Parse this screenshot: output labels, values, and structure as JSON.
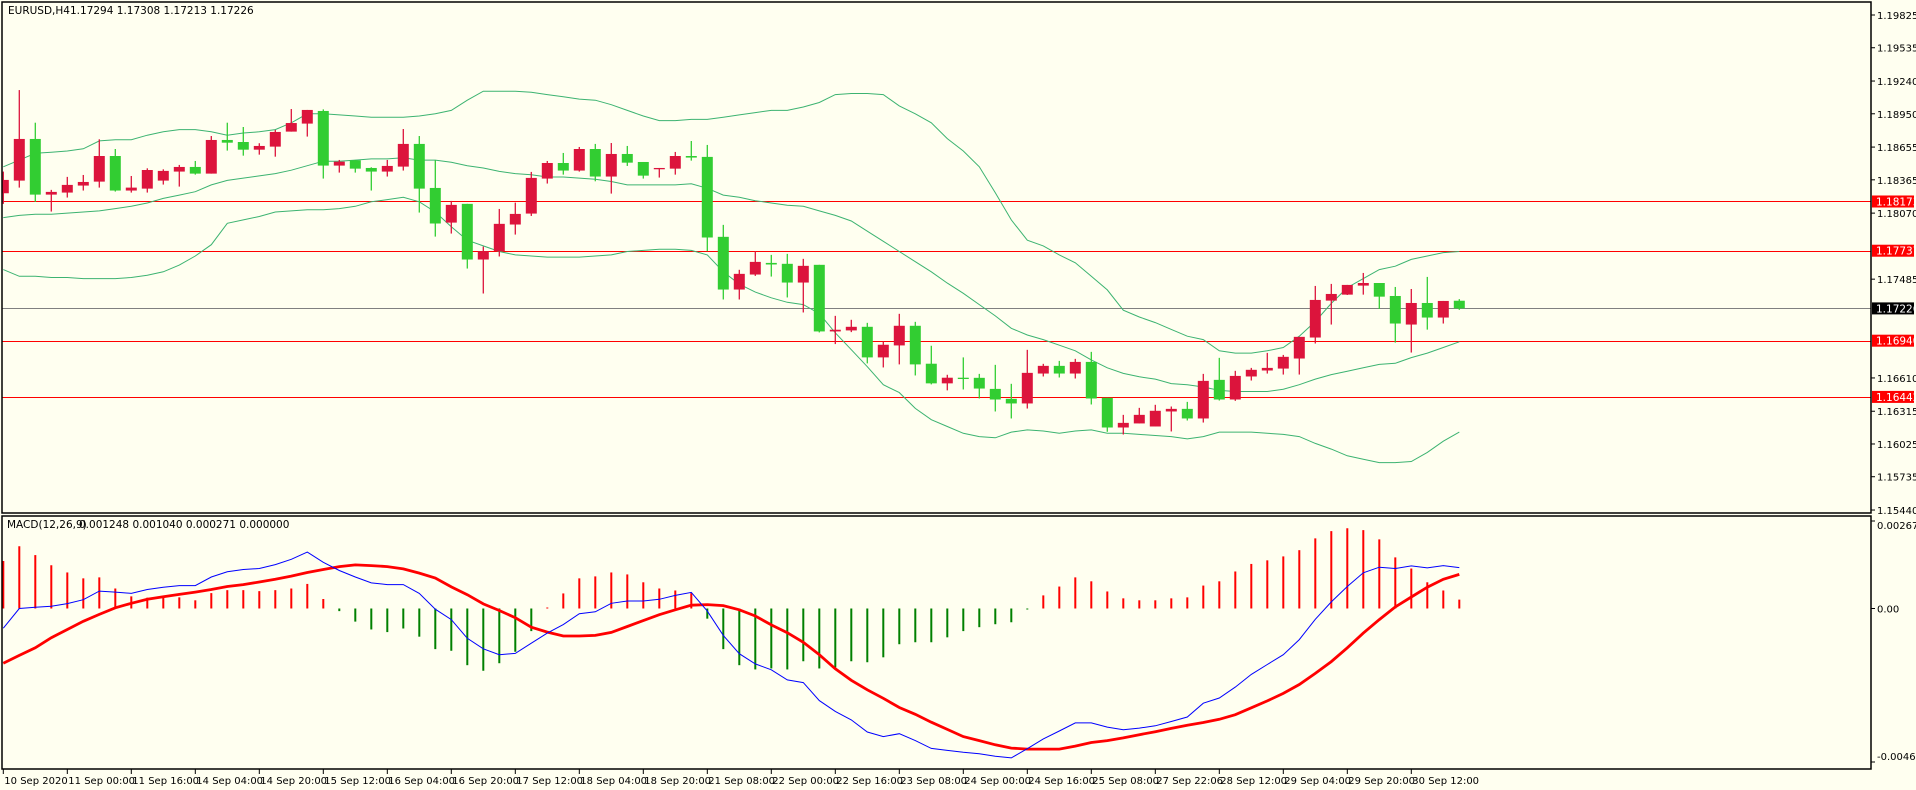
{
  "header": {
    "symbol": "EURUSD,H4",
    "ohlc": "1.17294 1.17308 1.17213 1.17226"
  },
  "macd_legend": {
    "label": "MACD(12,26,9)",
    "values": "0.001248 0.001040 0.000271 0.000000"
  },
  "colors": {
    "background": "#fffff0",
    "bull": "#dc143c",
    "bear": "#32cd32",
    "bands": "#3cb371",
    "level": "#ff0000",
    "bid": "#808080",
    "macd": "#0000ff",
    "signal": "#ff0000",
    "hist_pos": "#ff0000",
    "hist_neg": "#008000"
  },
  "price_axis": {
    "ticks": [
      "1.19825",
      "1.19535",
      "1.19240",
      "1.18950",
      "1.18655",
      "1.18365",
      "1.18070",
      "1.17485",
      "1.16610",
      "1.16315",
      "1.16025",
      "1.15735",
      "1.15440"
    ]
  },
  "levels": [
    {
      "price": "1.18173",
      "kind": "level"
    },
    {
      "price": "1.17737",
      "kind": "level"
    },
    {
      "price": "1.16940",
      "kind": "level"
    },
    {
      "price": "1.16442",
      "kind": "level"
    },
    {
      "price": "1.17226",
      "kind": "bid"
    }
  ],
  "macd_axis": {
    "ticks": [
      "0.00267",
      "0.00",
      "-0.004685"
    ]
  },
  "time_axis": {
    "labels": [
      "10 Sep 2020",
      "11 Sep 00:00",
      "11 Sep 16:00",
      "14 Sep 04:00",
      "14 Sep 20:00",
      "15 Sep 12:00",
      "16 Sep 04:00",
      "16 Sep 20:00",
      "17 Sep 12:00",
      "18 Sep 04:00",
      "18 Sep 20:00",
      "21 Sep 08:00",
      "22 Sep 00:00",
      "22 Sep 16:00",
      "23 Sep 08:00",
      "24 Sep 00:00",
      "24 Sep 16:00",
      "25 Sep 08:00",
      "27 Sep 22:06",
      "28 Sep 12:00",
      "29 Sep 04:00",
      "29 Sep 20:00",
      "30 Sep 12:00"
    ],
    "every_n_bars": 4
  },
  "chart_data": {
    "type": "candlestick",
    "title": "EURUSD,H4",
    "ylim": [
      1.154,
      1.1995
    ],
    "ohlc": [
      [
        1.18246,
        1.18438,
        1.18152,
        1.18364
      ],
      [
        1.18358,
        1.1916,
        1.18296,
        1.18727
      ],
      [
        1.18727,
        1.18871,
        1.18169,
        1.18234
      ],
      [
        1.18234,
        1.18276,
        1.18084,
        1.18258
      ],
      [
        1.18252,
        1.18391,
        1.18208,
        1.1832
      ],
      [
        1.18314,
        1.18408,
        1.1827,
        1.18346
      ],
      [
        1.18349,
        1.18724,
        1.18296,
        1.18576
      ],
      [
        1.18576,
        1.18638,
        1.18261,
        1.1827
      ],
      [
        1.1827,
        1.18399,
        1.18252,
        1.18296
      ],
      [
        1.18287,
        1.18467,
        1.18252,
        1.18452
      ],
      [
        1.18358,
        1.18458,
        1.18323,
        1.18444
      ],
      [
        1.18438,
        1.18497,
        1.18305,
        1.18479
      ],
      [
        1.18479,
        1.18532,
        1.18411,
        1.1842
      ],
      [
        1.1842,
        1.18753,
        1.1842,
        1.18718
      ],
      [
        1.18718,
        1.18871,
        1.18624,
        1.18694
      ],
      [
        1.187,
        1.18833,
        1.18579,
        1.18632
      ],
      [
        1.18632,
        1.18689,
        1.18588,
        1.18665
      ],
      [
        1.18659,
        1.18807,
        1.1857,
        1.18789
      ],
      [
        1.18792,
        1.18992,
        1.18792,
        1.18868
      ],
      [
        1.18863,
        1.18984,
        1.18748,
        1.18984
      ],
      [
        1.18975,
        1.18989,
        1.18376,
        1.18491
      ],
      [
        1.18491,
        1.18541,
        1.18429,
        1.18526
      ],
      [
        1.18538,
        1.18541,
        1.18429,
        1.18464
      ],
      [
        1.1847,
        1.18476,
        1.1827,
        1.18438
      ],
      [
        1.18438,
        1.18541,
        1.18394,
        1.18488
      ],
      [
        1.18482,
        1.18815,
        1.18447,
        1.18683
      ],
      [
        1.18683,
        1.18753,
        1.18075,
        1.18287
      ],
      [
        1.18293,
        1.18538,
        1.17862,
        1.17978
      ],
      [
        1.17986,
        1.18178,
        1.17889,
        1.18143
      ],
      [
        1.18152,
        1.18152,
        1.17579,
        1.17659
      ],
      [
        1.17659,
        1.17774,
        1.17358,
        1.17733
      ],
      [
        1.17733,
        1.18107,
        1.17686,
        1.17975
      ],
      [
        1.17969,
        1.18163,
        1.1788,
        1.18063
      ],
      [
        1.18066,
        1.18435,
        1.18045,
        1.18382
      ],
      [
        1.18376,
        1.18532,
        1.18332,
        1.18514
      ],
      [
        1.18514,
        1.18603,
        1.18411,
        1.18447
      ],
      [
        1.18447,
        1.18656,
        1.18438,
        1.18638
      ],
      [
        1.18638,
        1.18683,
        1.18352,
        1.18394
      ],
      [
        1.18394,
        1.18691,
        1.18243,
        1.18594
      ],
      [
        1.18594,
        1.18665,
        1.18488,
        1.18517
      ],
      [
        1.18523,
        1.18523,
        1.18376,
        1.18402
      ],
      [
        1.18464,
        1.1847,
        1.18385,
        1.1847
      ],
      [
        1.18464,
        1.18612,
        1.18411,
        1.18576
      ],
      [
        1.18576,
        1.18709,
        1.18535,
        1.18562
      ],
      [
        1.18568,
        1.18674,
        1.17733,
        1.17854
      ],
      [
        1.1786,
        1.17966,
        1.17305,
        1.17393
      ],
      [
        1.17393,
        1.17568,
        1.17305,
        1.17532
      ],
      [
        1.17526,
        1.17733,
        1.17514,
        1.17638
      ],
      [
        1.17629,
        1.177,
        1.17508,
        1.17615
      ],
      [
        1.17621,
        1.17709,
        1.17323,
        1.17455
      ],
      [
        1.17455,
        1.17665,
        1.1719,
        1.17603
      ],
      [
        1.17612,
        1.17612,
        1.17013,
        1.17022
      ],
      [
        1.17022,
        1.1716,
        1.1691,
        1.17037
      ],
      [
        1.17031,
        1.17125,
        1.17016,
        1.17063
      ],
      [
        1.17063,
        1.17098,
        1.16739,
        1.16792
      ],
      [
        1.16792,
        1.16933,
        1.16703,
        1.16904
      ],
      [
        1.16898,
        1.17178,
        1.1673,
        1.17072
      ],
      [
        1.17072,
        1.17107,
        1.16632,
        1.1673
      ],
      [
        1.16736,
        1.16895,
        1.16553,
        1.16562
      ],
      [
        1.16562,
        1.16638,
        1.165,
        1.16612
      ],
      [
        1.16612,
        1.16792,
        1.16508,
        1.16606
      ],
      [
        1.16611,
        1.16646,
        1.16428,
        1.16516
      ],
      [
        1.16513,
        1.16726,
        1.16313,
        1.16419
      ],
      [
        1.16425,
        1.16558,
        1.16251,
        1.16384
      ],
      [
        1.16384,
        1.16859,
        1.16339,
        1.16655
      ],
      [
        1.16649,
        1.16735,
        1.16623,
        1.16717
      ],
      [
        1.16717,
        1.16761,
        1.16614,
        1.16649
      ],
      [
        1.16649,
        1.16779,
        1.16605,
        1.16752
      ],
      [
        1.16752,
        1.16841,
        1.16375,
        1.16428
      ],
      [
        1.16434,
        1.16434,
        1.16133,
        1.16171
      ],
      [
        1.16171,
        1.16283,
        1.16109,
        1.16212
      ],
      [
        1.16207,
        1.16345,
        1.16207,
        1.16283
      ],
      [
        1.1618,
        1.16372,
        1.1618,
        1.16319
      ],
      [
        1.16313,
        1.16357,
        1.16136,
        1.16336
      ],
      [
        1.16336,
        1.16398,
        1.16233,
        1.16251
      ],
      [
        1.16251,
        1.16646,
        1.16215,
        1.16584
      ],
      [
        1.16593,
        1.16788,
        1.1641,
        1.16419
      ],
      [
        1.16419,
        1.16673,
        1.16407,
        1.16628
      ],
      [
        1.16623,
        1.16699,
        1.16587,
        1.16682
      ],
      [
        1.16676,
        1.16832,
        1.16649,
        1.16699
      ],
      [
        1.16693,
        1.16814,
        1.1664,
        1.16797
      ],
      [
        1.16782,
        1.16974,
        1.1664,
        1.16974
      ],
      [
        1.16968,
        1.17425,
        1.16915,
        1.17301
      ],
      [
        1.17295,
        1.17443,
        1.17083,
        1.17354
      ],
      [
        1.17348,
        1.17434,
        1.17345,
        1.17434
      ],
      [
        1.17428,
        1.1754,
        1.17348,
        1.17451
      ],
      [
        1.17451,
        1.17451,
        1.17221,
        1.1733
      ],
      [
        1.17336,
        1.17416,
        1.16923,
        1.17092
      ],
      [
        1.17083,
        1.17398,
        1.16835,
        1.17274
      ],
      [
        1.17274,
        1.17505,
        1.17038,
        1.17145
      ],
      [
        1.17145,
        1.17292,
        1.17092,
        1.17292
      ],
      [
        1.17294,
        1.17308,
        1.17213,
        1.17226
      ]
    ],
    "bollinger": {
      "upper": [
        1.1848,
        1.1854,
        1.186,
        1.1861,
        1.1862,
        1.1864,
        1.1871,
        1.1872,
        1.1872,
        1.1876,
        1.1879,
        1.1881,
        1.1881,
        1.1879,
        1.1876,
        1.1878,
        1.1879,
        1.1881,
        1.1887,
        1.1895,
        1.1895,
        1.1894,
        1.1893,
        1.1892,
        1.1892,
        1.1892,
        1.1893,
        1.1895,
        1.1898,
        1.1907,
        1.1915,
        1.1915,
        1.1915,
        1.1914,
        1.1912,
        1.191,
        1.1908,
        1.1907,
        1.1903,
        1.1898,
        1.1893,
        1.1889,
        1.1889,
        1.189,
        1.189,
        1.1892,
        1.1894,
        1.1896,
        1.1898,
        1.1898,
        1.1901,
        1.1905,
        1.1912,
        1.1913,
        1.1913,
        1.1912,
        1.1902,
        1.1895,
        1.1887,
        1.1873,
        1.1862,
        1.1848,
        1.1825,
        1.1801,
        1.1783,
        1.1778,
        1.177,
        1.1763,
        1.1751,
        1.1739,
        1.1721,
        1.1715,
        1.171,
        1.1704,
        1.1698,
        1.1695,
        1.1685,
        1.1683,
        1.1683,
        1.1685,
        1.1688,
        1.1698,
        1.1711,
        1.1727,
        1.1741,
        1.1749,
        1.1757,
        1.176,
        1.1766,
        1.1769,
        1.1772,
        1.1773
      ],
      "middle": [
        1.1803,
        1.1805,
        1.1806,
        1.1806,
        1.1807,
        1.1808,
        1.1809,
        1.1811,
        1.1813,
        1.1816,
        1.182,
        1.1823,
        1.1826,
        1.1832,
        1.1836,
        1.1838,
        1.184,
        1.1842,
        1.1845,
        1.1849,
        1.1853,
        1.1853,
        1.1854,
        1.1855,
        1.1855,
        1.1856,
        1.1854,
        1.1854,
        1.1852,
        1.1849,
        1.1847,
        1.1844,
        1.1842,
        1.1841,
        1.1839,
        1.1839,
        1.1838,
        1.1837,
        1.1835,
        1.1832,
        1.1832,
        1.1832,
        1.1832,
        1.1833,
        1.1829,
        1.1823,
        1.1821,
        1.1818,
        1.1816,
        1.1814,
        1.1813,
        1.1809,
        1.1805,
        1.18,
        1.1791,
        1.1782,
        1.1773,
        1.1764,
        1.1755,
        1.1745,
        1.1736,
        1.1726,
        1.1716,
        1.1705,
        1.1699,
        1.1695,
        1.169,
        1.1685,
        1.1677,
        1.167,
        1.1665,
        1.1662,
        1.166,
        1.1656,
        1.1655,
        1.1653,
        1.165,
        1.1649,
        1.1649,
        1.1649,
        1.1651,
        1.1655,
        1.166,
        1.1664,
        1.1667,
        1.167,
        1.1673,
        1.1674,
        1.1679,
        1.1683,
        1.1688,
        1.1693
      ],
      "lower": [
        1.1757,
        1.1751,
        1.1751,
        1.175,
        1.175,
        1.1749,
        1.1749,
        1.1749,
        1.175,
        1.1752,
        1.1755,
        1.1761,
        1.1769,
        1.1779,
        1.1798,
        1.1801,
        1.1804,
        1.1808,
        1.1809,
        1.181,
        1.181,
        1.1811,
        1.1813,
        1.1817,
        1.1819,
        1.1821,
        1.1817,
        1.1808,
        1.1795,
        1.1783,
        1.1778,
        1.1773,
        1.177,
        1.1769,
        1.1768,
        1.1768,
        1.1768,
        1.1769,
        1.177,
        1.1773,
        1.1774,
        1.1775,
        1.1775,
        1.1774,
        1.177,
        1.1755,
        1.1744,
        1.1737,
        1.1732,
        1.1728,
        1.1726,
        1.1718,
        1.1701,
        1.1686,
        1.1671,
        1.1655,
        1.1648,
        1.1634,
        1.1624,
        1.1618,
        1.1612,
        1.1609,
        1.1608,
        1.1613,
        1.1615,
        1.1614,
        1.1612,
        1.1614,
        1.1615,
        1.1612,
        1.1612,
        1.1611,
        1.161,
        1.1609,
        1.1607,
        1.1609,
        1.1613,
        1.1613,
        1.1613,
        1.1612,
        1.1611,
        1.1609,
        1.1603,
        1.1598,
        1.1592,
        1.1589,
        1.1586,
        1.1586,
        1.1587,
        1.1595,
        1.1605,
        1.1613
      ]
    },
    "macd": {
      "ylim": [
        -0.004685,
        0.00267
      ],
      "histogram": [
        0.00145,
        0.0019,
        0.00163,
        0.00132,
        0.0011,
        0.00092,
        0.00095,
        0.00061,
        0.00037,
        0.00033,
        0.00035,
        0.00034,
        0.00025,
        0.00047,
        0.00056,
        0.00056,
        0.00053,
        0.00056,
        0.00061,
        0.00075,
        0.00029,
        -8e-05,
        -0.0004,
        -0.00064,
        -0.00072,
        -0.00061,
        -0.00086,
        -0.00124,
        -0.00129,
        -0.00173,
        -0.0019,
        -0.00167,
        -0.00132,
        -0.00069,
        1e-05,
        0.00046,
        0.00092,
        0.00098,
        0.0011,
        0.00104,
        0.0008,
        0.00061,
        0.00055,
        0.00047,
        -0.00031,
        -0.00124,
        -0.00173,
        -0.00186,
        -0.00183,
        -0.00186,
        -0.00161,
        -0.00183,
        -0.0018,
        -0.00161,
        -0.00164,
        -0.00149,
        -0.00109,
        -0.00103,
        -0.00103,
        -0.00088,
        -0.00069,
        -0.00057,
        -0.00048,
        -0.00042,
        -2e-05,
        0.0004,
        0.00067,
        0.00095,
        0.00083,
        0.00052,
        0.00031,
        0.00025,
        0.00025,
        0.00031,
        0.00034,
        0.0007,
        0.00083,
        0.00113,
        0.00136,
        0.00147,
        0.00159,
        0.00178,
        0.00214,
        0.00236,
        0.00245,
        0.00239,
        0.00211,
        0.00156,
        0.00122,
        0.0008,
        0.00055,
        0.000271
      ],
      "main": [
        -0.0006,
        0,
        4e-05,
        7e-05,
        0.00015,
        0.00027,
        0.00053,
        0.0005,
        0.00046,
        0.00058,
        0.00065,
        0.0007,
        0.0007,
        0.00096,
        0.00112,
        0.00119,
        0.00122,
        0.00134,
        0.0015,
        0.00172,
        0.00141,
        0.00116,
        0.00096,
        0.00078,
        0.00073,
        0.00073,
        0.00046,
        -2e-05,
        -0.00034,
        -0.00091,
        -0.00123,
        -0.00141,
        -0.00137,
        -0.00106,
        -0.00075,
        -0.00049,
        -0.00016,
        -0.0001,
        0.00016,
        0.00023,
        0.00023,
        0.00028,
        0.0004,
        0.00049,
        -8e-05,
        -0.00082,
        -0.00138,
        -0.00169,
        -0.00187,
        -0.00218,
        -0.00226,
        -0.00281,
        -0.00314,
        -0.0034,
        -0.00377,
        -0.00391,
        -0.00382,
        -0.00403,
        -0.00427,
        -0.00433,
        -0.00439,
        -0.00443,
        -0.00451,
        -0.00456,
        -0.00428,
        -0.00398,
        -0.00374,
        -0.00349,
        -0.00349,
        -0.00362,
        -0.0037,
        -0.00365,
        -0.00358,
        -0.00345,
        -0.00331,
        -0.00289,
        -0.00273,
        -0.0024,
        -0.00201,
        -0.00171,
        -0.00141,
        -0.00095,
        -0.00033,
        0.0002,
        0.00067,
        0.00109,
        0.00126,
        0.00122,
        0.0013,
        0.00124,
        0.00131,
        0.001248
      ],
      "signal": [
        -0.00167,
        -0.00143,
        -0.0012,
        -0.00089,
        -0.00064,
        -0.00039,
        -0.00018,
        2e-05,
        0.00016,
        0.00028,
        0.00036,
        0.00043,
        0.0005,
        0.00058,
        0.00067,
        0.00073,
        0.00081,
        0.00089,
        0.00099,
        0.0011,
        0.00119,
        0.00128,
        0.00133,
        0.00131,
        0.00128,
        0.00121,
        0.00108,
        0.00093,
        0.00066,
        0.00042,
        0.00014,
        -6e-05,
        -0.00028,
        -0.00057,
        -0.00072,
        -0.00084,
        -0.00084,
        -0.00082,
        -0.00073,
        -0.00055,
        -0.00037,
        -0.00019,
        -4e-05,
        0.0001,
        0.00012,
        9e-05,
        -4e-05,
        -0.00023,
        -0.0005,
        -0.00074,
        -0.00103,
        -0.00141,
        -0.00184,
        -0.00219,
        -0.00248,
        -0.00274,
        -0.00302,
        -0.00323,
        -0.00347,
        -0.00369,
        -0.00391,
        -0.00403,
        -0.00416,
        -0.00426,
        -0.00429,
        -0.00429,
        -0.00429,
        -0.0042,
        -0.00409,
        -0.00403,
        -0.00395,
        -0.00385,
        -0.00376,
        -0.00366,
        -0.00356,
        -0.00348,
        -0.00338,
        -0.00324,
        -0.00303,
        -0.00282,
        -0.00259,
        -0.00232,
        -0.00198,
        -0.00162,
        -0.0012,
        -0.00075,
        -0.00034,
        5e-05,
        0.00035,
        0.00065,
        0.00089,
        0.00104
      ]
    }
  }
}
